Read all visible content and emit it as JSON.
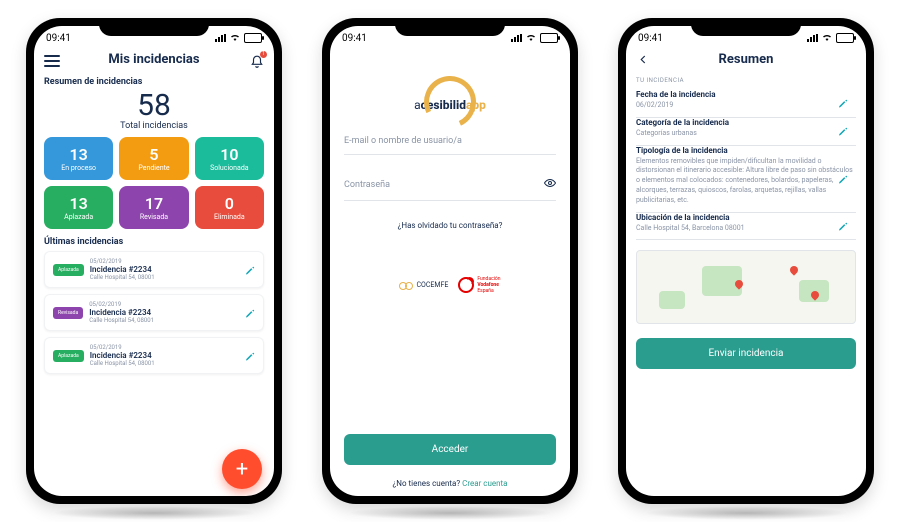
{
  "status": {
    "time": "09:41"
  },
  "phone1": {
    "title": "Mis incidencias",
    "bell_badge": "1",
    "summary_label": "Resumen de incidencias",
    "total_value": "58",
    "total_label": "Total incidencias",
    "tiles": [
      {
        "value": "13",
        "label": "En proceso",
        "color": "#3498db"
      },
      {
        "value": "5",
        "label": "Pendiente",
        "color": "#f39c12"
      },
      {
        "value": "10",
        "label": "Solucionada",
        "color": "#1abc9c"
      },
      {
        "value": "13",
        "label": "Aplazada",
        "color": "#27ae60"
      },
      {
        "value": "17",
        "label": "Revisada",
        "color": "#8e44ad"
      },
      {
        "value": "0",
        "label": "Eliminada",
        "color": "#e74c3c"
      }
    ],
    "latest_label": "Últimas incidencias",
    "items": [
      {
        "chip": "Aplazada",
        "chip_color": "#27ae60",
        "date": "05/02/2019",
        "id": "Incidencia #2234",
        "address": "Calle Hospital 54, 08001"
      },
      {
        "chip": "Revisada",
        "chip_color": "#8e44ad",
        "date": "05/02/2019",
        "id": "Incidencia #2234",
        "address": "Calle Hospital 54, 08001"
      },
      {
        "chip": "Aplazada",
        "chip_color": "#27ae60",
        "date": "05/02/2019",
        "id": "Incidencia #2234",
        "address": "Calle Hospital 54, 08001"
      }
    ],
    "fab": "+"
  },
  "phone2": {
    "brand_a": "a",
    "brand_mid": "cesibilid",
    "brand_app": "app",
    "email_ph": "E-mail o nombre de usuario/a",
    "pass_ph": "Contraseña",
    "forgot": "¿Has olvidado tu contraseña?",
    "partner1": "COCEMFE",
    "partner2_l1": "Fundación",
    "partner2_l2": "Vodafone",
    "partner2_l3": "España",
    "login_btn": "Acceder",
    "noacct_q": "¿No tienes cuenta? ",
    "noacct_link": "Crear cuenta"
  },
  "phone3": {
    "title": "Resumen",
    "crumb": "TU INCIDENCIA",
    "fields": [
      {
        "label": "Fecha de la incidencia",
        "value": "06/02/2019",
        "editable": true
      },
      {
        "label": "Categoría de la incidencia",
        "value": "Categorías urbanas",
        "editable": true
      },
      {
        "label": "Tipología de la incidencia",
        "value": "Elementos removibles que impiden/dificultan la movilidad o distorsionan el itinerario accesible: Altura libre de paso sin obstáculos o elementos mal colocados: contenedores, bolardos, papeleras, alcorques, terrazas, quioscos, farolas, arquetas, rejillas, vallas publicitarias, etc.",
        "editable": true
      },
      {
        "label": "Ubicación de la incidencia",
        "value": "Calle Hospital 54, Barcelona 08001",
        "editable": true
      }
    ],
    "submit_btn": "Enviar incidencia"
  }
}
